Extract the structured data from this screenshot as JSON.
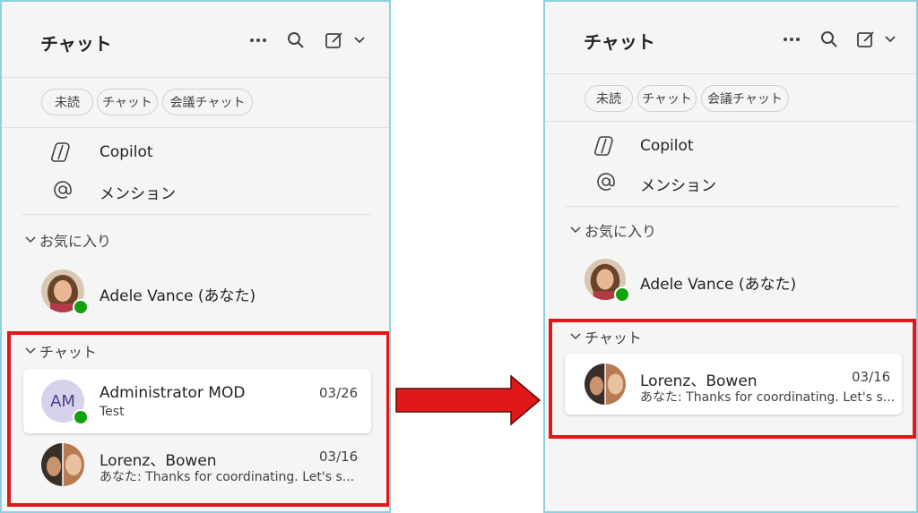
{
  "header": {
    "title": "チャット",
    "more_icon": "ellipsis-icon",
    "search_icon": "search-icon",
    "compose_icon": "compose-icon"
  },
  "filters": [
    "未読",
    "チャット",
    "会議チャット"
  ],
  "nav": [
    {
      "label": "Copilot",
      "icon": "copilot-icon"
    },
    {
      "label": "メンション",
      "icon": "at-icon"
    }
  ],
  "favorites": {
    "header": "お気に入り",
    "items": [
      {
        "name": "Adele Vance (あなた)",
        "status": "available"
      }
    ]
  },
  "chats_before": {
    "header": "チャット",
    "items": [
      {
        "name": "Administrator MOD",
        "initials": "AM",
        "date": "03/26",
        "preview": "Test"
      },
      {
        "name": "Lorenz、Bowen",
        "date": "03/16",
        "preview": "あなた: Thanks for coordinating. Let's s..."
      }
    ]
  },
  "chats_after": {
    "header": "チャット",
    "items": [
      {
        "name": "Lorenz、Bowen",
        "date": "03/16",
        "preview": "あなた: Thanks for coordinating. Let's s..."
      }
    ]
  },
  "colors": {
    "accent_red": "#e01818",
    "status_green": "#13a10e",
    "panel_border": "#8fd0e0"
  }
}
